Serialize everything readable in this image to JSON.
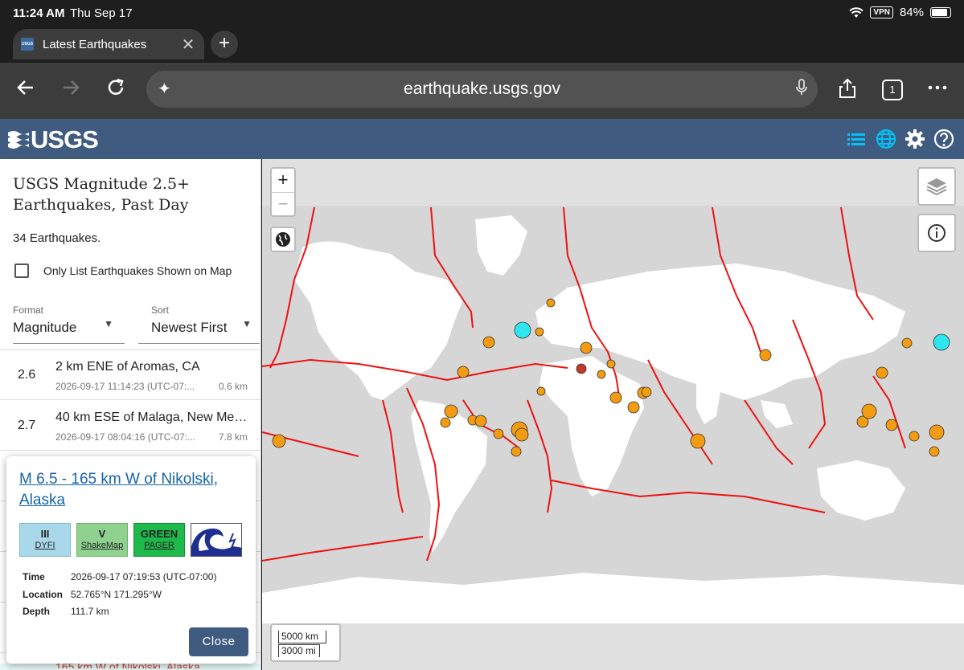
{
  "status": {
    "time": "11:24 AM",
    "date": "Thu Sep 17",
    "vpn": "VPN",
    "battery": "84%"
  },
  "browser": {
    "tab_title": "Latest Earthquakes",
    "url": "earthquake.usgs.gov",
    "tab_count": "1",
    "favicon_text": "USGS"
  },
  "header": {
    "logo_text": "USGS",
    "accent": "#00c3f7"
  },
  "sidebar": {
    "title": "USGS Magnitude 2.5+ Earthquakes, Past Day",
    "count": "34 Earthquakes.",
    "only_map_label": "Only List Earthquakes Shown on Map",
    "format": {
      "label": "Format",
      "value": "Magnitude"
    },
    "sort": {
      "label": "Sort",
      "value": "Newest First"
    },
    "earthquakes": [
      {
        "mag": "2.6",
        "place": "2 km ENE of Aromas, CA",
        "time": "2026-09-17 11:14:23 (UTC-07:...",
        "depth": "0.6 km"
      },
      {
        "mag": "2.7",
        "place": "40 km ESE of Malaga, New Mexico",
        "time": "2026-09-17 08:04:16 (UTC-07:...",
        "depth": "7.8 km"
      }
    ],
    "bottom_peek": "165 km W of Nikolski, Alaska"
  },
  "popup": {
    "title": "M 6.5 - 165 km W of Nikolski, Alaska",
    "badges": [
      {
        "big": "III",
        "small": "DYFI",
        "color": "#a8d8ea"
      },
      {
        "big": "V",
        "small": "ShakeMap",
        "color": "#8fd28f"
      },
      {
        "big": "GREEN",
        "small": "PAGER",
        "color": "#1fb84a"
      }
    ],
    "details": [
      {
        "key": "Time",
        "value": "2026-09-17 07:19:53 (UTC-07:00)"
      },
      {
        "key": "Location",
        "value": "52.765°N 171.295°W"
      },
      {
        "key": "Depth",
        "value": "111.7 km"
      }
    ],
    "close_label": "Close"
  },
  "map": {
    "scale_km": "5000 km",
    "scale_mi": "3000 mi",
    "colors": {
      "ocean": "#e0e0e0",
      "land": "#ffffff",
      "ice": "#ffffff",
      "plate": "#ee1111",
      "quake": "#f39c12",
      "highlight": "#2ee6f0",
      "deep": "#c0392b"
    }
  }
}
